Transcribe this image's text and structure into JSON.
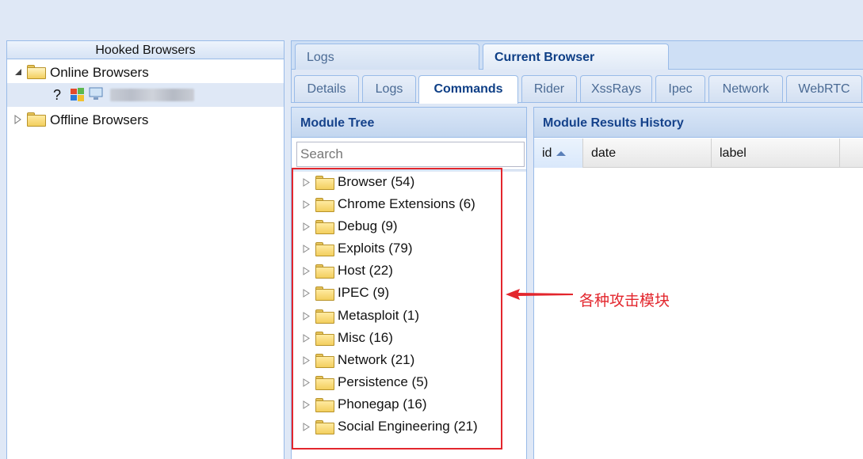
{
  "left_panel": {
    "header": "Hooked Browsers",
    "online": "Online Browsers",
    "offline": "Offline Browsers",
    "browser_entry": {
      "unknown_mark": "?",
      "ip_blurred": "██ ███ ██ ██"
    }
  },
  "top_tabs": [
    {
      "label": "Logs",
      "active": false
    },
    {
      "label": "Current Browser",
      "active": true
    }
  ],
  "sub_tabs": [
    {
      "label": "Details",
      "active": false
    },
    {
      "label": "Logs",
      "active": false
    },
    {
      "label": "Commands",
      "active": true
    },
    {
      "label": "Rider",
      "active": false
    },
    {
      "label": "XssRays",
      "active": false
    },
    {
      "label": "Ipec",
      "active": false
    },
    {
      "label": "Network",
      "active": false
    },
    {
      "label": "WebRTC",
      "active": false
    }
  ],
  "module_tree": {
    "title": "Module Tree",
    "search_placeholder": "Search",
    "items": [
      "Browser (54)",
      "Chrome Extensions (6)",
      "Debug (9)",
      "Exploits (79)",
      "Host (22)",
      "IPEC (9)",
      "Metasploit (1)",
      "Misc (16)",
      "Network (21)",
      "Persistence (5)",
      "Phonegap (16)",
      "Social Engineering (21)"
    ]
  },
  "results": {
    "title": "Module Results History",
    "columns": [
      "id",
      "date",
      "label"
    ]
  },
  "annotation": {
    "text": "各种攻击模块",
    "color": "#e3262d"
  },
  "colors": {
    "accent_border": "#99bbe8",
    "header_text": "#15428b",
    "folder": "#f3cf5e"
  }
}
